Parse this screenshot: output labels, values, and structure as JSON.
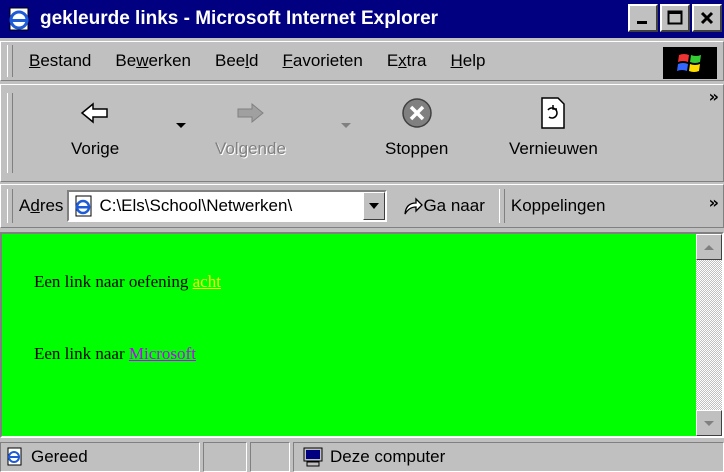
{
  "window": {
    "title": "gekleurde links - Microsoft Internet Explorer",
    "controls": {
      "minimize": "_",
      "maximize": "□",
      "close": "×"
    }
  },
  "menu": {
    "items": [
      "Bestand",
      "Bewerken",
      "Beeld",
      "Favorieten",
      "Extra",
      "Help"
    ],
    "access_keys": [
      "B",
      "w",
      "l",
      "F",
      "x",
      "H"
    ]
  },
  "toolbar": {
    "back_label": "Vorige",
    "forward_label": "Volgende",
    "stop_label": "Stoppen",
    "refresh_label": "Vernieuwen",
    "forward_enabled": false,
    "more": "»"
  },
  "address": {
    "label": "Adres",
    "value": "C:\\Els\\School\\Netwerken\\",
    "go_label": "Ga naar",
    "links_label": "Koppelingen",
    "more": "»"
  },
  "page": {
    "background": "#00ff00",
    "line1_text": "Een link naar oefening ",
    "line1_link": "acht",
    "line1_link_color": "#ffff00",
    "line2_text": "Een link naar ",
    "line2_link": "Microsoft",
    "line2_link_color": "#c000ff"
  },
  "status": {
    "text": "Gereed",
    "zone": "Deze computer"
  }
}
